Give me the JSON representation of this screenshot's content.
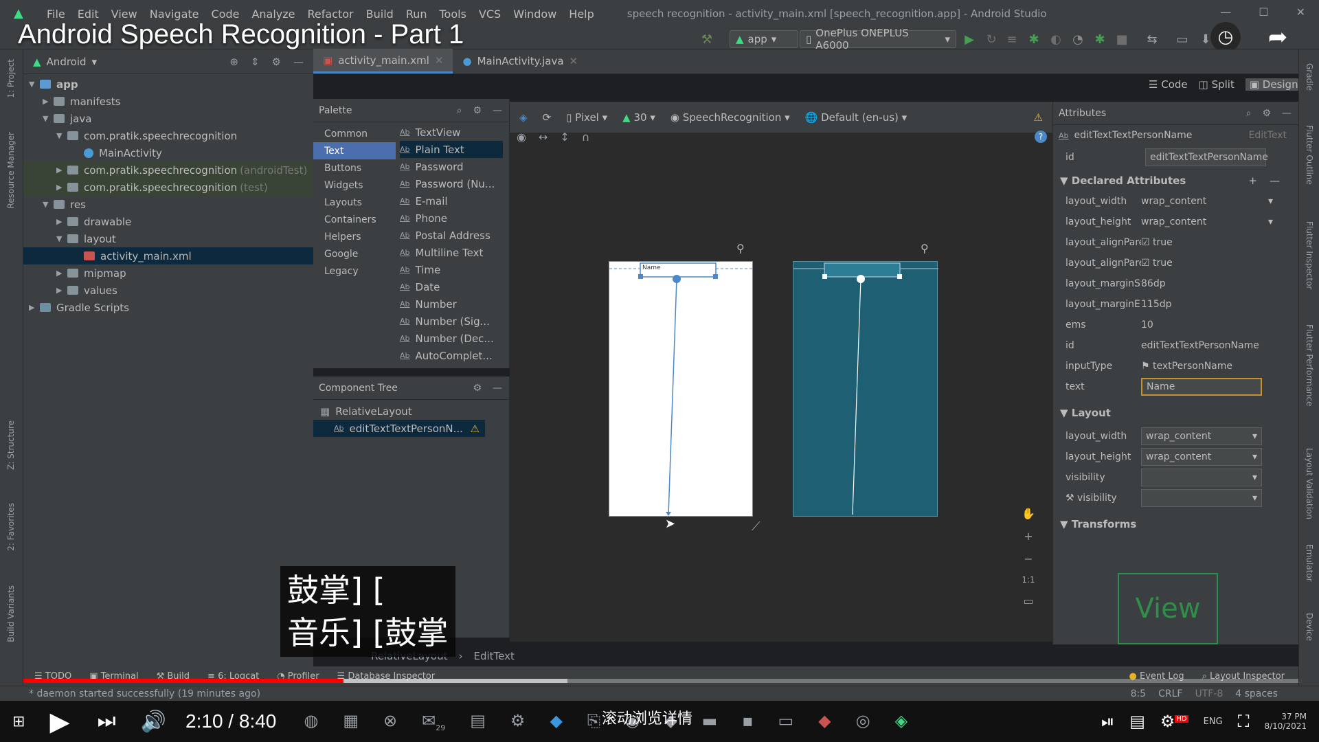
{
  "video": {
    "title": "Android Speech Recognition - Part 1",
    "time": "2:10 / 8:40",
    "subtitle": "鼓掌] [\n音乐] [鼓掌",
    "hint": "滚动浏览详情",
    "hd": "HD"
  },
  "menu": [
    "File",
    "Edit",
    "View",
    "Navigate",
    "Code",
    "Analyze",
    "Refactor",
    "Build",
    "Run",
    "Tools",
    "VCS",
    "Window",
    "Help"
  ],
  "window_title": "speech recognition - activity_main.xml [speech_recognition.app] - Android Studio",
  "toolbar": {
    "config": "app",
    "device": "OnePlus ONEPLUS A6000"
  },
  "project": {
    "header": "Android",
    "items": [
      {
        "label": "app"
      },
      {
        "label": "manifests"
      },
      {
        "label": "java"
      },
      {
        "label": "com.pratik.speechrecognition"
      },
      {
        "label": "MainActivity"
      },
      {
        "label": "com.pratik.speechrecognition",
        "suffix": "(androidTest)"
      },
      {
        "label": "com.pratik.speechrecognition",
        "suffix": "(test)"
      },
      {
        "label": "res"
      },
      {
        "label": "drawable"
      },
      {
        "label": "layout"
      },
      {
        "label": "activity_main.xml"
      },
      {
        "label": "mipmap"
      },
      {
        "label": "values"
      },
      {
        "label": "Gradle Scripts"
      }
    ]
  },
  "left_tabs": [
    "1: Project",
    "Resource Manager",
    "Z: Structure",
    "2: Favorites",
    "Build Variants"
  ],
  "tabs": [
    "activity_main.xml",
    "MainActivity.java"
  ],
  "view_modes": [
    "Code",
    "Split",
    "Design"
  ],
  "palette": {
    "title": "Palette",
    "categories": [
      "Common",
      "Text",
      "Buttons",
      "Widgets",
      "Layouts",
      "Containers",
      "Helpers",
      "Google",
      "Legacy"
    ],
    "items": [
      "TextView",
      "Plain Text",
      "Password",
      "Password (Nu...",
      "E-mail",
      "Phone",
      "Postal Address",
      "Multiline Text",
      "Time",
      "Date",
      "Number",
      "Number (Sig...",
      "Number (Dec...",
      "AutoComplet..."
    ]
  },
  "component_tree": {
    "title": "Component Tree",
    "root": "RelativeLayout",
    "child": "editTextTextPersonN..."
  },
  "design_bar": {
    "device": "Pixel",
    "api": "30",
    "theme": "SpeechRecognition",
    "locale": "Default (en-us)"
  },
  "preview": {
    "hint_text": "Name",
    "breadcrumb": [
      "RelativeLayout",
      "EditText"
    ],
    "zoom_fit": "1:1"
  },
  "attributes": {
    "title": "Attributes",
    "component": "editTextTextPersonName",
    "component_type": "EditText",
    "id_label": "id",
    "id_value": "editTextTextPersonName",
    "declared_title": "Declared Attributes",
    "declared": [
      {
        "k": "layout_width",
        "v": "wrap_content"
      },
      {
        "k": "layout_height",
        "v": "wrap_content"
      },
      {
        "k": "layout_alignPare...",
        "v": "true"
      },
      {
        "k": "layout_alignPare...",
        "v": "true"
      },
      {
        "k": "layout_marginSt...",
        "v": "86dp"
      },
      {
        "k": "layout_marginEnd",
        "v": "115dp"
      },
      {
        "k": "ems",
        "v": "10"
      },
      {
        "k": "id",
        "v": "editTextTextPersonName"
      },
      {
        "k": "inputType",
        "v": "textPersonName"
      },
      {
        "k": "text",
        "v": "Name"
      }
    ],
    "layout_title": "Layout",
    "layout": [
      {
        "k": "layout_width",
        "v": "wrap_content"
      },
      {
        "k": "layout_height",
        "v": "wrap_content"
      },
      {
        "k": "visibility",
        "v": ""
      },
      {
        "k": "visibility",
        "v": ""
      }
    ],
    "transforms_title": "Transforms",
    "view_label": "View"
  },
  "right_tabs": [
    "Gradle",
    "Flutter Outline",
    "Flutter Inspector",
    "Flutter Performance",
    "Layout Validation",
    "Emulator",
    "Device"
  ],
  "bottom_tabs": [
    "TODO",
    "Terminal",
    "Build",
    "6: Logcat",
    "Profiler",
    "Database Inspector",
    "Event Log",
    "Layout Inspector"
  ],
  "status": {
    "message": "* daemon started successfully (19 minutes ago)",
    "pos": "8:5",
    "eol": "CRLF",
    "enc": "UTF-8",
    "indent": "4 spaces"
  },
  "taskbar": {
    "lang": "ENG",
    "time": "37 PM",
    "date": "8/10/2021",
    "badge": "29"
  }
}
